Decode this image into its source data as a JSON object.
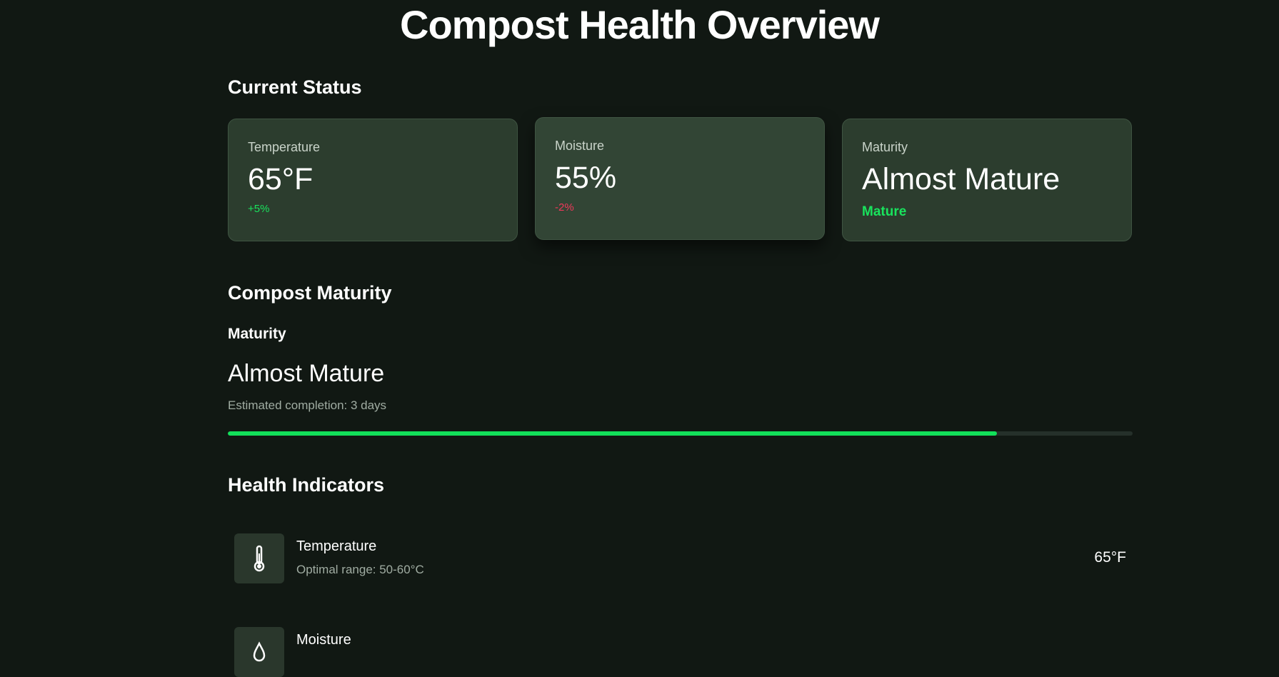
{
  "page": {
    "title": "Compost Health Overview"
  },
  "current_status": {
    "heading": "Current Status",
    "cards": [
      {
        "label": "Temperature",
        "value": "65°F",
        "change": "+5%"
      },
      {
        "label": "Moisture",
        "value": "55%",
        "change": "-2%"
      },
      {
        "label": "Maturity",
        "value": "Almost Mature",
        "status": "Mature"
      }
    ]
  },
  "compost_maturity": {
    "heading": "Compost Maturity",
    "label": "Maturity",
    "value": "Almost Mature",
    "estimate": "Estimated completion: 3 days",
    "progress_percent": 85
  },
  "health_indicators": {
    "heading": "Health Indicators",
    "items": [
      {
        "name": "Temperature",
        "range": "Optimal range: 50-60°C",
        "value": "65°F",
        "icon": "thermometer-icon"
      },
      {
        "name": "Moisture",
        "range": "",
        "value": "",
        "icon": "droplet-icon"
      }
    ]
  },
  "colors": {
    "background": "#111813",
    "card": "#2c3d2e",
    "accent": "#12e05a",
    "negative": "#f0385a"
  }
}
